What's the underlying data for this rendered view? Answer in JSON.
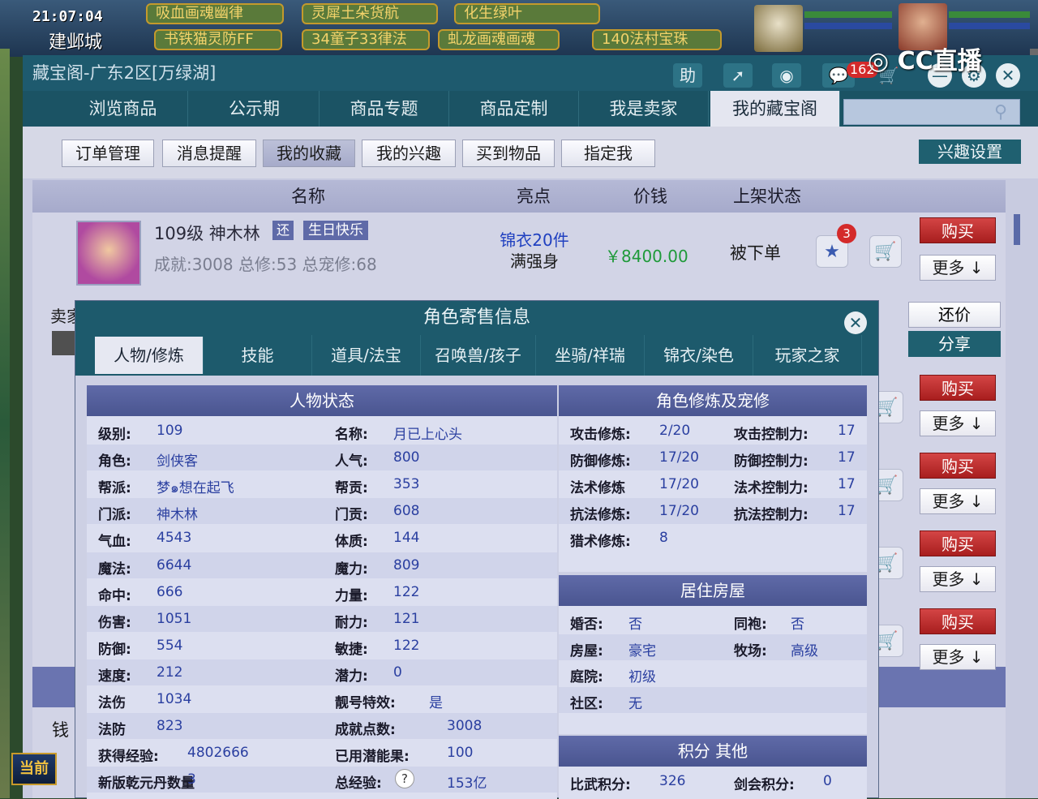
{
  "game_header": {
    "clock": "21:07:04",
    "city": "建邺城",
    "tags_row1": [
      "吸血画魂幽律",
      "灵犀土朵货航",
      "化生绿叶"
    ],
    "tags_row2": [
      "书铁猫灵防FF",
      "34童子33律法",
      "虬龙画魂画魂",
      "140法村宝珠"
    ],
    "stream_logo": "CC直播",
    "bottom_label": "当前"
  },
  "window": {
    "title": "藏宝阁-广东2区[万绿湖]",
    "title_icons": [
      "助",
      "share-icon",
      "stop-icon",
      "chat-icon",
      "cart-icon",
      "minimize-icon",
      "settings-icon",
      "close-icon"
    ],
    "chat_count": "162"
  },
  "nav": {
    "tabs": [
      "浏览商品",
      "公示期",
      "商品专题",
      "商品定制",
      "我是卖家",
      "我的藏宝阁"
    ],
    "active_index": 5,
    "search_placeholder": ""
  },
  "subnav": {
    "buttons": [
      "订单管理",
      "消息提醒",
      "我的收藏",
      "我的兴趣",
      "买到物品",
      "指定我"
    ],
    "active": "我的收藏",
    "interest_settings": "兴趣设置"
  },
  "list": {
    "headers": [
      "名称",
      "亮点",
      "价钱",
      "上架状态"
    ],
    "item": {
      "title": "109级 神木林",
      "badge1": "还",
      "badge2": "生日快乐",
      "subtitle": "成就:3008 总修:53 总宠修:68",
      "highlight_line1": "锦衣20件",
      "highlight_line2": "满强身",
      "price": "￥8400.00",
      "status": "被下单",
      "star_count": "3"
    },
    "buy_label": "购买",
    "more_label": "更多",
    "bargain_label": "还价",
    "share_label": "分享",
    "partial_seller": "卖家",
    "partial_money": "钱"
  },
  "popup": {
    "title": "角色寄售信息",
    "tabs": [
      "人物/修炼",
      "技能",
      "道具/法宝",
      "召唤兽/孩子",
      "坐骑/祥瑞",
      "锦衣/染色",
      "玩家之家"
    ],
    "active_tab": "人物/修炼",
    "status_title": "人物状态",
    "status_left": [
      {
        "label": "级别:",
        "value": "109"
      },
      {
        "label": "角色:",
        "value": "剑侠客"
      },
      {
        "label": "帮派:",
        "value": "梦๑想在起飞"
      },
      {
        "label": "门派:",
        "value": "神木林"
      },
      {
        "label": "气血:",
        "value": "4543"
      },
      {
        "label": "魔法:",
        "value": "6644"
      },
      {
        "label": "命中:",
        "value": "666"
      },
      {
        "label": "伤害:",
        "value": "1051"
      },
      {
        "label": "防御:",
        "value": "554"
      },
      {
        "label": "速度:",
        "value": "212"
      },
      {
        "label": "法伤",
        "value": "1034"
      },
      {
        "label": "法防",
        "value": "823"
      },
      {
        "label": "获得经验:",
        "value": "4802666"
      },
      {
        "label": "新版乾元丹数量",
        "value": "3"
      }
    ],
    "status_right": [
      {
        "label": "名称:",
        "value": "月已上心头"
      },
      {
        "label": "人气:",
        "value": "800"
      },
      {
        "label": "帮贡:",
        "value": "353"
      },
      {
        "label": "门贡:",
        "value": "608"
      },
      {
        "label": "体质:",
        "value": "144"
      },
      {
        "label": "魔力:",
        "value": "809"
      },
      {
        "label": "力量:",
        "value": "122"
      },
      {
        "label": "耐力:",
        "value": "121"
      },
      {
        "label": "敏捷:",
        "value": "122"
      },
      {
        "label": "潜力:",
        "value": "0"
      },
      {
        "label": "靓号特效:",
        "value": "是"
      },
      {
        "label": "成就点数:",
        "value": "3008"
      },
      {
        "label": "已用潜能果:",
        "value": "100"
      },
      {
        "label": "总经验:",
        "value": "153亿"
      }
    ],
    "cultivation_title": "角色修炼及宠修",
    "cultivation": [
      {
        "l1": "攻击修炼:",
        "v1": "2/20",
        "l2": "攻击控制力:",
        "v2": "17"
      },
      {
        "l1": "防御修炼:",
        "v1": "17/20",
        "l2": "防御控制力:",
        "v2": "17"
      },
      {
        "l1": "法术修炼",
        "v1": "17/20",
        "l2": "法术控制力:",
        "v2": "17"
      },
      {
        "l1": "抗法修炼:",
        "v1": "17/20",
        "l2": "抗法控制力:",
        "v2": "17"
      },
      {
        "l1": "猎术修炼:",
        "v1": "8",
        "l2": "",
        "v2": ""
      }
    ],
    "house_title": "居住房屋",
    "house": [
      {
        "l1": "婚否:",
        "v1": "否",
        "l2": "同袍:",
        "v2": "否"
      },
      {
        "l1": "房屋:",
        "v1": "豪宅",
        "l2": "牧场:",
        "v2": "高级"
      },
      {
        "l1": "庭院:",
        "v1": "初级",
        "l2": "",
        "v2": ""
      },
      {
        "l1": "社区:",
        "v1": "无",
        "l2": "",
        "v2": ""
      }
    ],
    "other_title": "积分 其他",
    "other": [
      {
        "l1": "比武积分:",
        "v1": "326",
        "l2": "剑会积分:",
        "v2": "0"
      }
    ]
  }
}
